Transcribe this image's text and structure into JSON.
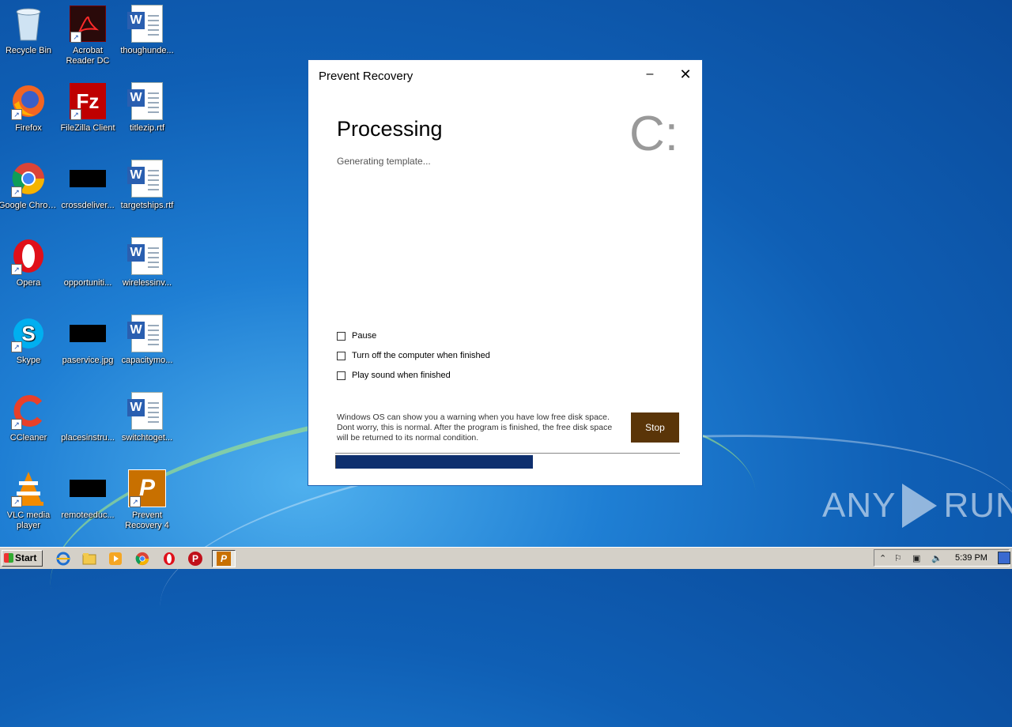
{
  "desktop_icons": [
    {
      "label": "Recycle Bin",
      "icon": "recycle-bin-icon"
    },
    {
      "label": "Acrobat Reader DC",
      "icon": "acrobat-icon"
    },
    {
      "label": "thoughunde...",
      "icon": "word-doc-icon"
    },
    {
      "label": "Firefox",
      "icon": "firefox-icon"
    },
    {
      "label": "FileZilla Client",
      "icon": "filezilla-icon"
    },
    {
      "label": "titlezip.rtf",
      "icon": "word-doc-icon"
    },
    {
      "label": "Google Chrome",
      "icon": "chrome-icon"
    },
    {
      "label": "crossdeliver...",
      "icon": "black-file-icon"
    },
    {
      "label": "targetships.rtf",
      "icon": "word-doc-icon"
    },
    {
      "label": "Opera",
      "icon": "opera-icon"
    },
    {
      "label": "opportuniti...",
      "icon": "blank-file-icon"
    },
    {
      "label": "wirelessinv...",
      "icon": "word-doc-icon"
    },
    {
      "label": "Skype",
      "icon": "skype-icon"
    },
    {
      "label": "paservice.jpg",
      "icon": "black-file-icon"
    },
    {
      "label": "capacitymo...",
      "icon": "word-doc-icon"
    },
    {
      "label": "CCleaner",
      "icon": "ccleaner-icon"
    },
    {
      "label": "placesinstru...",
      "icon": "blank-file-icon"
    },
    {
      "label": "switchtoget...",
      "icon": "word-doc-icon"
    },
    {
      "label": "VLC media player",
      "icon": "vlc-icon"
    },
    {
      "label": "remoteeduc...",
      "icon": "black-file-icon"
    },
    {
      "label": "Prevent Recovery 4",
      "icon": "prevent-recovery-icon"
    }
  ],
  "dialog": {
    "title": "Prevent Recovery",
    "minimize_symbol": "–",
    "close_symbol": "✕",
    "heading": "Processing",
    "drive": "C:",
    "status": "Generating template...",
    "options": [
      {
        "label": "Pause",
        "checked": false
      },
      {
        "label": "Turn off the computer when finished",
        "checked": false
      },
      {
        "label": "Play sound when finished",
        "checked": false
      }
    ],
    "note": "Windows OS can show you a warning when you have low free disk space. Dont worry, this is normal. After the program is finished, the free disk space will be returned to its normal condition.",
    "stop_label": "Stop",
    "progress_fraction": 0.57
  },
  "watermark": {
    "left": "ANY",
    "right": "RUN"
  },
  "taskbar": {
    "start_label": "Start",
    "clock": "5:39 PM",
    "pinned": [
      "ie-icon",
      "explorer-icon",
      "media-player-icon",
      "chrome-icon",
      "opera-icon",
      "prevent-recovery-icon",
      "prevent-recovery-active-icon"
    ]
  }
}
